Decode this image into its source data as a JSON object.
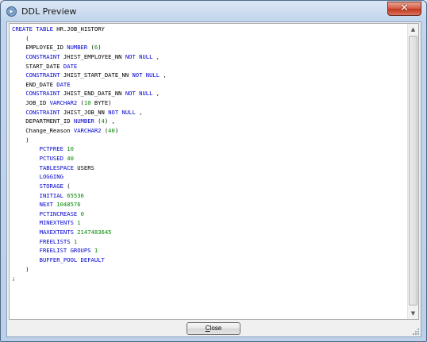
{
  "window": {
    "title": "DDL Preview",
    "close_glyph": "✕"
  },
  "footer": {
    "close_label_mnemonic": "C",
    "close_label_rest": "lose"
  },
  "colors": {
    "keyword": "#0000d0",
    "number": "#008a00",
    "text": "#000000"
  },
  "code_lines": [
    [
      [
        "kw",
        "CREATE TABLE "
      ],
      [
        "plain",
        "HR.JOB_HISTORY"
      ]
    ],
    [
      [
        "plain",
        "    ("
      ]
    ],
    [
      [
        "plain",
        "    EMPLOYEE_ID "
      ],
      [
        "kw",
        "NUMBER"
      ],
      [
        "plain",
        " ("
      ],
      [
        "num",
        "6"
      ],
      [
        "plain",
        ")"
      ]
    ],
    [
      [
        "plain",
        "    "
      ],
      [
        "kw",
        "CONSTRAINT"
      ],
      [
        "plain",
        " JHIST_EMPLOYEE_NN "
      ],
      [
        "kw",
        "NOT NULL"
      ],
      [
        "plain",
        " ,"
      ]
    ],
    [
      [
        "plain",
        "    START_DATE "
      ],
      [
        "kw",
        "DATE"
      ]
    ],
    [
      [
        "plain",
        "    "
      ],
      [
        "kw",
        "CONSTRAINT"
      ],
      [
        "plain",
        " JHIST_START_DATE_NN "
      ],
      [
        "kw",
        "NOT NULL"
      ],
      [
        "plain",
        " ,"
      ]
    ],
    [
      [
        "plain",
        "    END_DATE "
      ],
      [
        "kw",
        "DATE"
      ]
    ],
    [
      [
        "plain",
        "    "
      ],
      [
        "kw",
        "CONSTRAINT"
      ],
      [
        "plain",
        " JHIST_END_DATE_NN "
      ],
      [
        "kw",
        "NOT NULL"
      ],
      [
        "plain",
        " ,"
      ]
    ],
    [
      [
        "plain",
        "    JOB_ID "
      ],
      [
        "kw",
        "VARCHAR2"
      ],
      [
        "plain",
        " ("
      ],
      [
        "num",
        "10"
      ],
      [
        "plain",
        " BYTE)"
      ]
    ],
    [
      [
        "plain",
        "    "
      ],
      [
        "kw",
        "CONSTRAINT"
      ],
      [
        "plain",
        " JHIST_JOB_NN "
      ],
      [
        "kw",
        "NOT NULL"
      ],
      [
        "plain",
        " ,"
      ]
    ],
    [
      [
        "plain",
        "    DEPARTMENT_ID "
      ],
      [
        "kw",
        "NUMBER"
      ],
      [
        "plain",
        " ("
      ],
      [
        "num",
        "4"
      ],
      [
        "plain",
        ") ,"
      ]
    ],
    [
      [
        "plain",
        "    Change_Reason "
      ],
      [
        "kw",
        "VARCHAR2"
      ],
      [
        "plain",
        " ("
      ],
      [
        "num",
        "40"
      ],
      [
        "plain",
        ")"
      ]
    ],
    [
      [
        "plain",
        "    )"
      ]
    ],
    [
      [
        "plain",
        "        "
      ],
      [
        "kw",
        "PCTFREE"
      ],
      [
        "plain",
        " "
      ],
      [
        "num",
        "10"
      ]
    ],
    [
      [
        "plain",
        "        "
      ],
      [
        "kw",
        "PCTUSED"
      ],
      [
        "plain",
        " "
      ],
      [
        "num",
        "40"
      ]
    ],
    [
      [
        "plain",
        "        "
      ],
      [
        "kw",
        "TABLESPACE"
      ],
      [
        "plain",
        " USERS"
      ]
    ],
    [
      [
        "plain",
        "        "
      ],
      [
        "kw",
        "LOGGING"
      ]
    ],
    [
      [
        "plain",
        "        "
      ],
      [
        "kw",
        "STORAGE"
      ],
      [
        "plain",
        " ("
      ]
    ],
    [
      [
        "plain",
        "        "
      ],
      [
        "kw",
        "INITIAL"
      ],
      [
        "plain",
        " "
      ],
      [
        "num",
        "65536"
      ]
    ],
    [
      [
        "plain",
        "        "
      ],
      [
        "kw",
        "NEXT"
      ],
      [
        "plain",
        " "
      ],
      [
        "num",
        "1048576"
      ]
    ],
    [
      [
        "plain",
        "        "
      ],
      [
        "kw",
        "PCTINCREASE"
      ],
      [
        "plain",
        " "
      ],
      [
        "num",
        "0"
      ]
    ],
    [
      [
        "plain",
        "        "
      ],
      [
        "kw",
        "MINEXTENTS"
      ],
      [
        "plain",
        " "
      ],
      [
        "num",
        "1"
      ]
    ],
    [
      [
        "plain",
        "        "
      ],
      [
        "kw",
        "MAXEXTENTS"
      ],
      [
        "plain",
        " "
      ],
      [
        "num",
        "2147483645"
      ]
    ],
    [
      [
        "plain",
        "        "
      ],
      [
        "kw",
        "FREELISTS"
      ],
      [
        "plain",
        " "
      ],
      [
        "num",
        "1"
      ]
    ],
    [
      [
        "plain",
        "        "
      ],
      [
        "kw",
        "FREELIST GROUPS"
      ],
      [
        "plain",
        " "
      ],
      [
        "num",
        "1"
      ]
    ],
    [
      [
        "plain",
        "        "
      ],
      [
        "kw",
        "BUFFER_POOL DEFAULT"
      ]
    ],
    [
      [
        "plain",
        "    )"
      ]
    ],
    [
      [
        "plain",
        ";"
      ]
    ]
  ]
}
